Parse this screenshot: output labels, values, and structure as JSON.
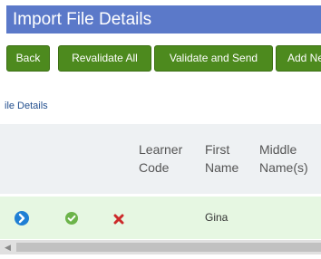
{
  "header": {
    "title": "Import File Details"
  },
  "toolbar": {
    "buttons": [
      {
        "label": "Back"
      },
      {
        "label": "Revalidate All"
      },
      {
        "label": "Validate and Send"
      },
      {
        "label": "Add Ne"
      }
    ]
  },
  "section": {
    "title": "ile Details"
  },
  "grid": {
    "columns": [
      {
        "label": "Learner Code",
        "lines": [
          "Learner",
          "Code"
        ]
      },
      {
        "label": "First Name",
        "lines": [
          "First",
          "Name"
        ]
      },
      {
        "label": "Middle Name(s)",
        "lines": [
          "Middle",
          "Name(s)"
        ]
      }
    ],
    "rows": [
      {
        "icons": [
          "arrow-right-circle-icon",
          "check-circle-icon",
          "delete-x-icon"
        ],
        "learner_code": "",
        "first_name": "Gina",
        "middle_names": ""
      }
    ]
  },
  "colors": {
    "header_bg": "#5b79c9",
    "button_bg": "#4d8a1e",
    "row_bg": "#e6f7e2",
    "grid_head_bg": "#eef1f3",
    "link_blue": "#24508f"
  }
}
